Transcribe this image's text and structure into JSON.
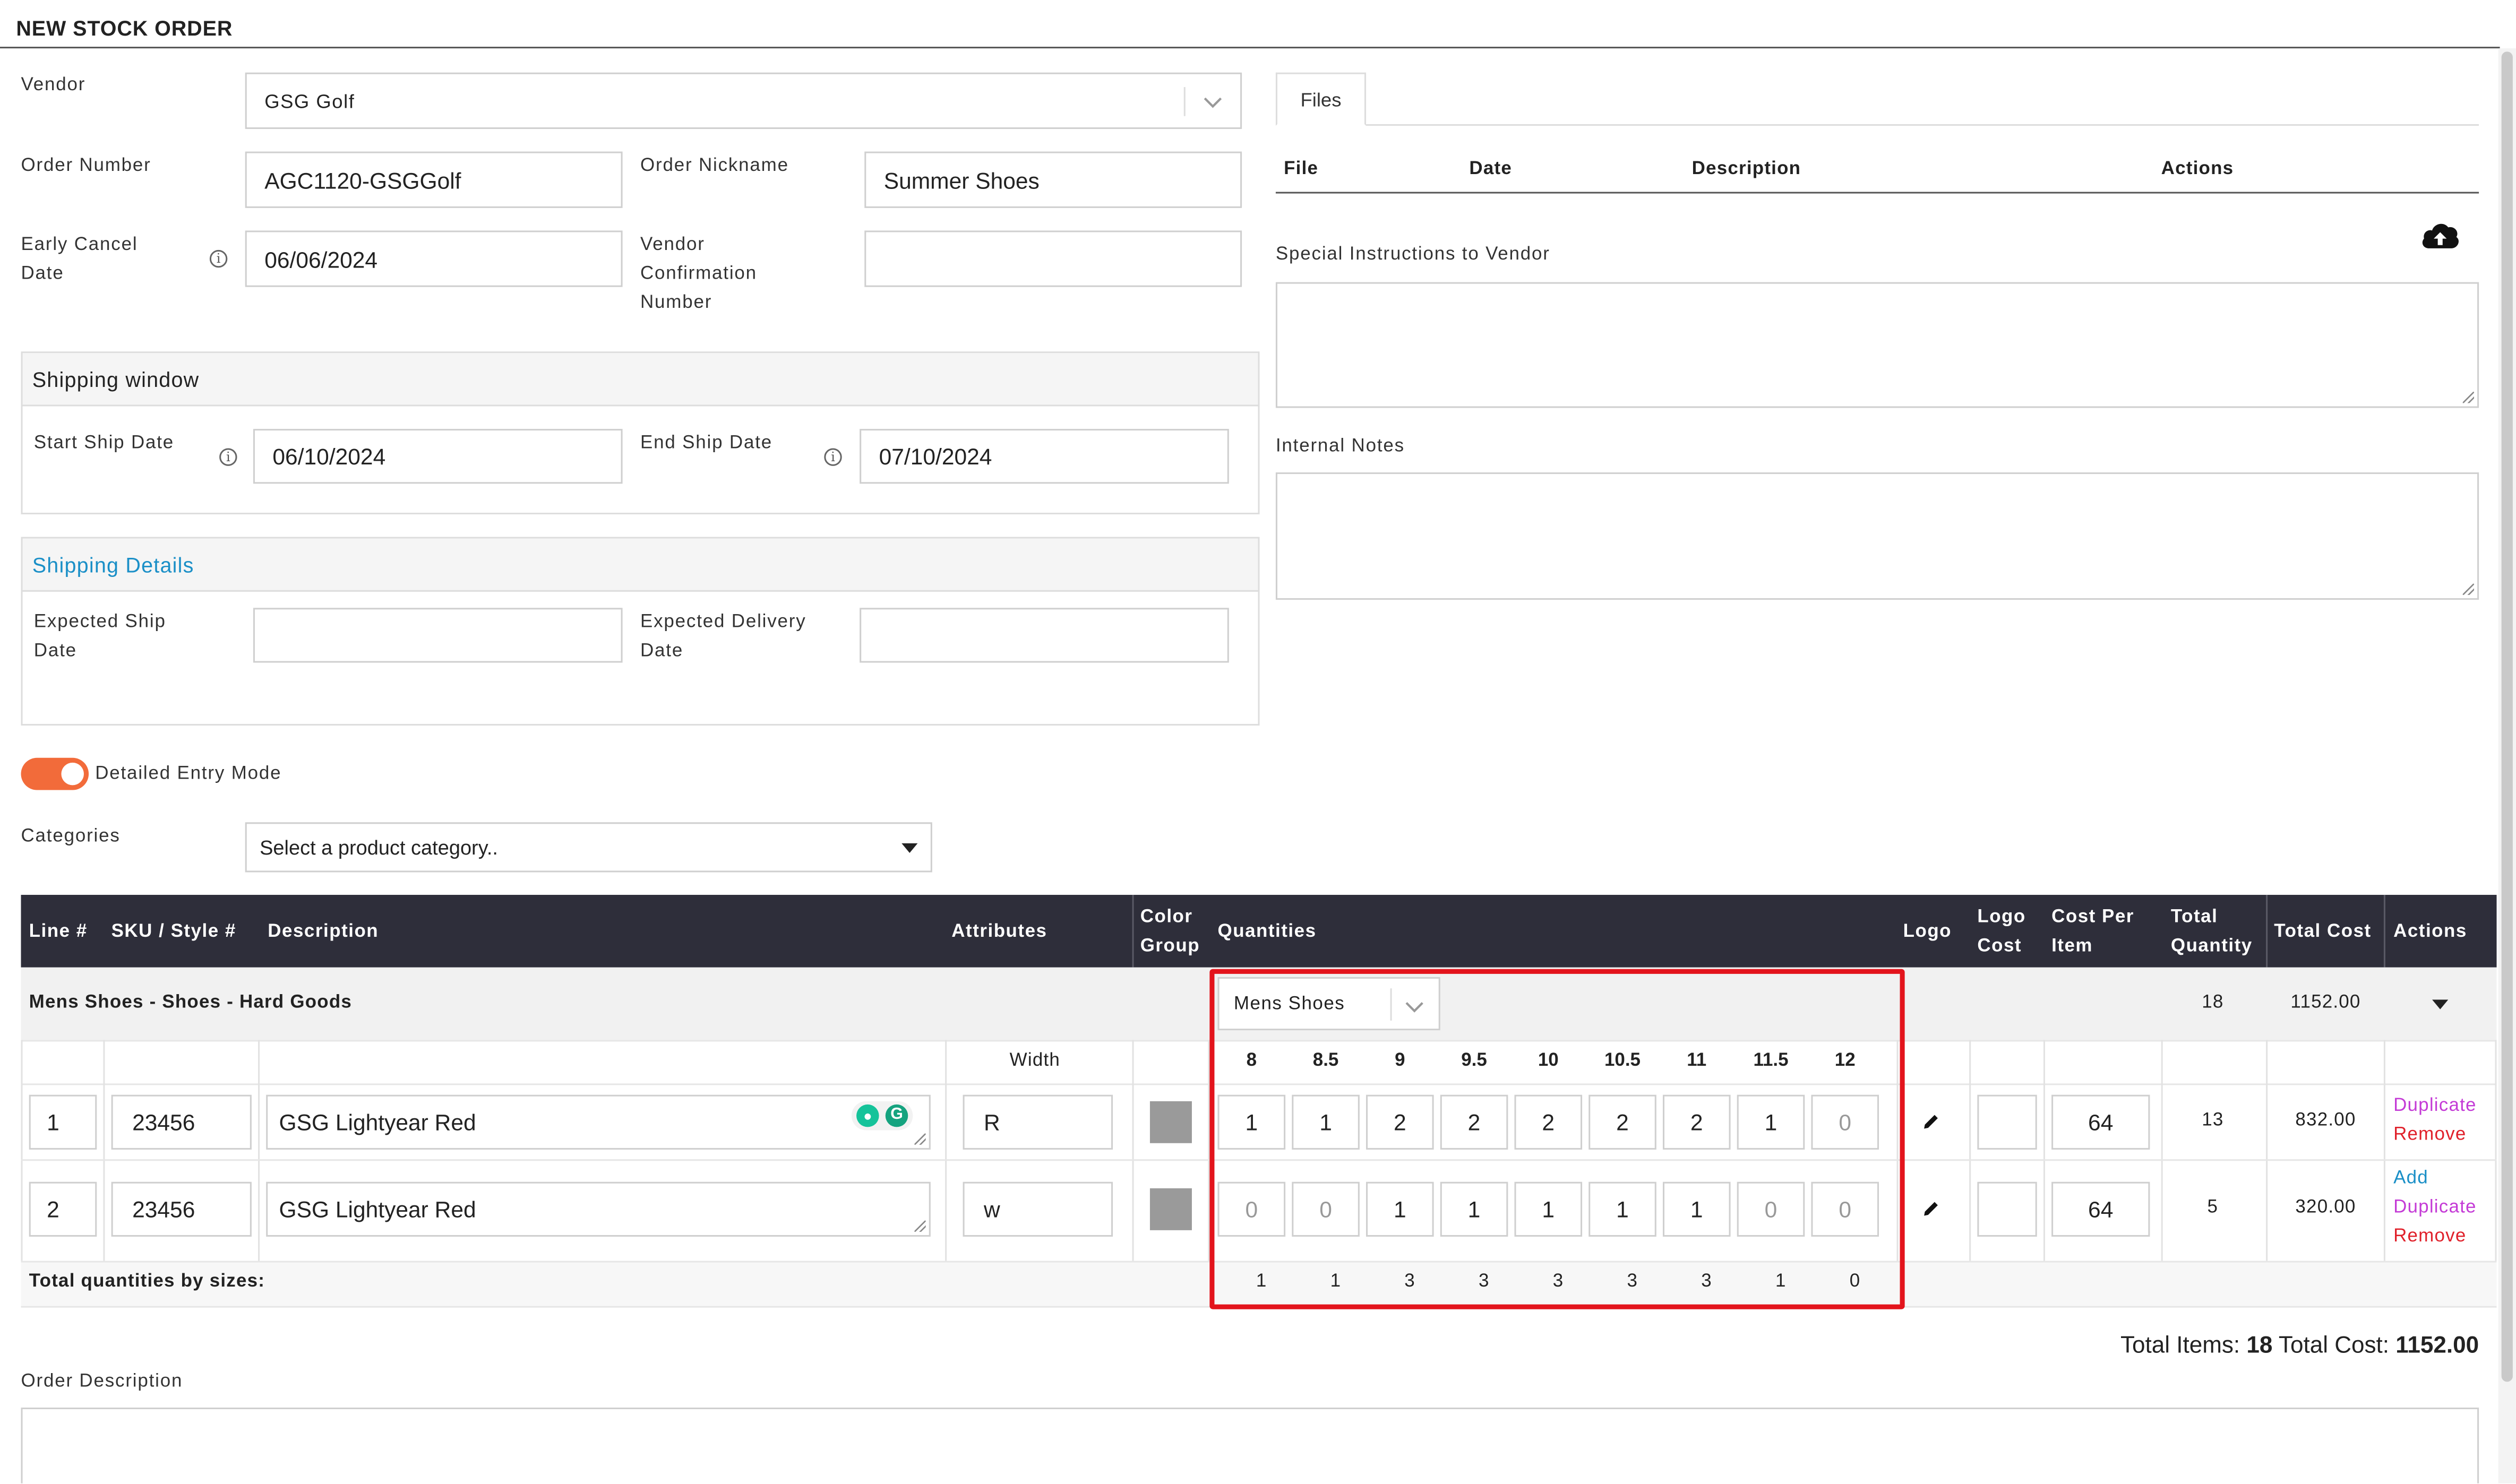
{
  "header": {
    "title": "NEW STOCK ORDER"
  },
  "form": {
    "vendor_label": "Vendor",
    "vendor_value": "GSG Golf",
    "order_number_label": "Order Number",
    "order_number_value": "AGC1120-GSGGolf",
    "order_nickname_label": "Order Nickname",
    "order_nickname_value": "Summer Shoes",
    "early_cancel_label_1": "Early Cancel",
    "early_cancel_label_2": "Date",
    "early_cancel_value": "06/06/2024",
    "vendor_conf_label_1": "Vendor",
    "vendor_conf_label_2": "Confirmation",
    "vendor_conf_label_3": "Number",
    "vendor_conf_value": ""
  },
  "shipping_window": {
    "title": "Shipping window",
    "start_label": "Start Ship Date",
    "start_value": "06/10/2024",
    "end_label": "End Ship Date",
    "end_value": "07/10/2024"
  },
  "shipping_details": {
    "title": "Shipping Details",
    "expected_ship_label_1": "Expected Ship",
    "expected_ship_label_2": "Date",
    "expected_delivery_label_1": "Expected Delivery",
    "expected_delivery_label_2": "Date"
  },
  "files": {
    "tab_label": "Files",
    "columns": [
      "File",
      "Date",
      "Description",
      "Actions"
    ]
  },
  "special_instructions_label": "Special Instructions to Vendor",
  "internal_notes_label": "Internal Notes",
  "detailed_entry_label": "Detailed Entry Mode",
  "categories": {
    "label": "Categories",
    "placeholder": "Select a product category.."
  },
  "table": {
    "headers": {
      "line": "Line #",
      "sku": "SKU / Style #",
      "description": "Description",
      "attributes": "Attributes",
      "color_group_1": "Color",
      "color_group_2": "Group",
      "quantities": "Quantities",
      "logo": "Logo",
      "logo_cost_1": "Logo",
      "logo_cost_2": "Cost",
      "cost_per_item_1": "Cost Per",
      "cost_per_item_2": "Item",
      "total_quantity_1": "Total",
      "total_quantity_2": "Quantity",
      "total_cost": "Total Cost",
      "actions": "Actions"
    },
    "group": {
      "name": "Mens Shoes - Shoes - Hard Goods",
      "size_run": "Mens Shoes",
      "total_quantity": "18",
      "total_cost": "1152.00"
    },
    "attribute_name": "Width",
    "sizes": [
      "8",
      "8.5",
      "9",
      "9.5",
      "10",
      "10.5",
      "11",
      "11.5",
      "12"
    ],
    "rows": [
      {
        "line": "1",
        "sku": "23456",
        "description": "GSG Lightyear Red",
        "width": "R",
        "quantities": [
          "1",
          "1",
          "2",
          "2",
          "2",
          "2",
          "2",
          "1",
          "0"
        ],
        "cost_per_item": "64",
        "total_quantity": "13",
        "total_cost": "832.00",
        "actions": [
          "Duplicate",
          "Remove"
        ]
      },
      {
        "line": "2",
        "sku": "23456",
        "description": "GSG Lightyear Red",
        "width": "w",
        "quantities": [
          "0",
          "0",
          "1",
          "1",
          "1",
          "1",
          "1",
          "0",
          "0"
        ],
        "cost_per_item": "64",
        "total_quantity": "5",
        "total_cost": "320.00",
        "actions": [
          "Add",
          "Duplicate",
          "Remove"
        ]
      }
    ],
    "totals_label": "Total quantities by sizes:",
    "size_totals": [
      "1",
      "1",
      "3",
      "3",
      "3",
      "3",
      "3",
      "1",
      "0"
    ]
  },
  "summary": {
    "items_label": "Total Items:",
    "items_value": "18",
    "cost_label": "Total Cost:",
    "cost_value": "1152.00"
  },
  "order_description_label": "Order Description",
  "colors": {
    "accent_orange": "#f26b3a",
    "link_blue": "#1a8fc7",
    "duplicate_magenta": "#c43bd6",
    "remove_red": "#e0202a",
    "highlight_red": "#e3141c",
    "table_header": "#2e2e3a"
  }
}
